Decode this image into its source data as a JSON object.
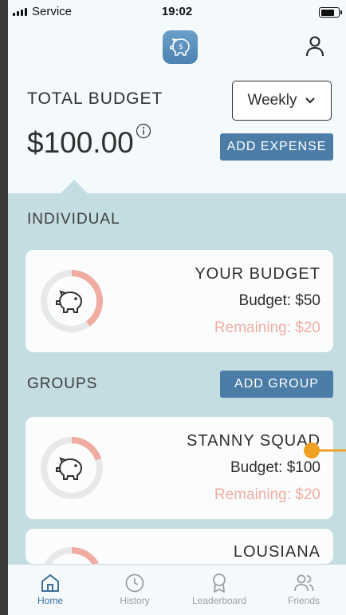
{
  "status_bar": {
    "carrier": "Service",
    "time": "19:02"
  },
  "header": {
    "total_label": "TOTAL BUDGET",
    "total_amount": "$100.00",
    "period_selected": "Weekly",
    "add_expense_label": "ADD EXPENSE"
  },
  "individual": {
    "section_title": "INDIVIDUAL",
    "card": {
      "name": "YOUR BUDGET",
      "budget": "Budget: $50",
      "remaining": "Remaining: $20",
      "remaining_fraction": 0.4
    }
  },
  "groups": {
    "section_title": "GROUPS",
    "add_group_label": "ADD GROUP",
    "cards": [
      {
        "name": "STANNY SQUAD",
        "budget": "Budget: $100",
        "remaining": "Remaining: $20",
        "remaining_fraction": 0.2
      },
      {
        "name": "LOUSIANA"
      }
    ]
  },
  "tab_bar": {
    "tabs": [
      {
        "label": "Home",
        "icon": "home-icon",
        "active": true
      },
      {
        "label": "History",
        "icon": "clock-icon",
        "active": false
      },
      {
        "label": "Leaderboard",
        "icon": "award-icon",
        "active": false
      },
      {
        "label": "Friends",
        "icon": "friends-icon",
        "active": false
      }
    ]
  },
  "colors": {
    "accent": "#4c7da7",
    "panel": "#c4dde2",
    "remaining": "#f0aca1",
    "text": "#2f2f2f",
    "tab_active": "#3d6f98",
    "tab_inactive": "#9aa0a3"
  }
}
